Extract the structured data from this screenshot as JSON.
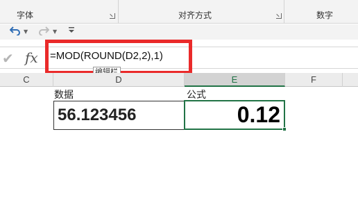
{
  "ribbon": {
    "groups": [
      {
        "label": "字体"
      },
      {
        "label": "对齐方式"
      },
      {
        "label": "数字"
      }
    ]
  },
  "quick_access": {
    "undo_icon": "undo-icon",
    "redo_icon": "redo-icon",
    "customize_icon": "customize-qat-icon"
  },
  "formula_bar": {
    "cancel_icon": "cancel-check-icon",
    "insert_function_label": "fx",
    "formula": "=MOD(ROUND(D2,2),1)",
    "tooltip": "编辑栏",
    "highlight_color": "#ea2a2a"
  },
  "columns": [
    {
      "label": "C"
    },
    {
      "label": "D"
    },
    {
      "label": "E",
      "selected": true
    },
    {
      "label": "F"
    }
  ],
  "cells": {
    "d_header": "数据",
    "e_header": "公式",
    "d2_value": "56.123456",
    "e2_value": "0.12"
  },
  "colors": {
    "selection_green": "#217346"
  }
}
